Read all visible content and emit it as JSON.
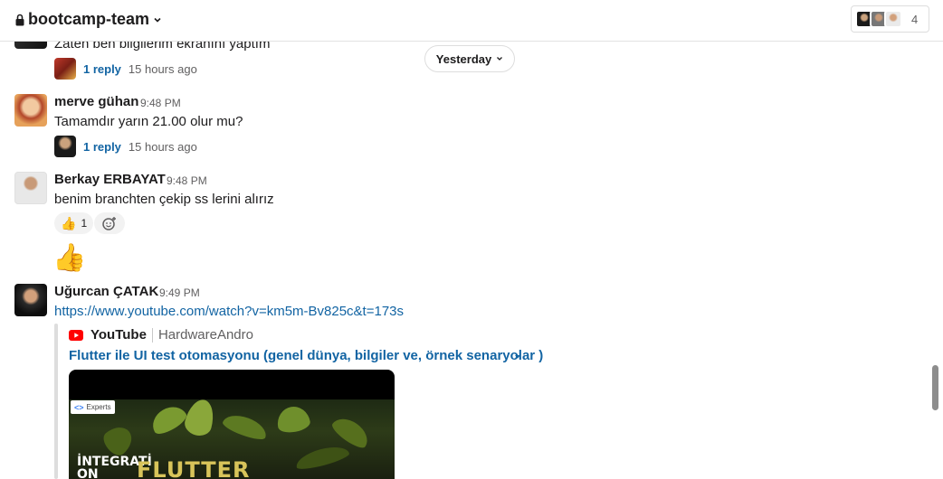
{
  "header": {
    "channel_name": "bootcamp-team",
    "member_count": "4"
  },
  "date_divider": "Yesterday",
  "messages": [
    {
      "text": "Zaten ben bilgilerim ekranını yaptım",
      "thread": {
        "reply_label": "1 reply",
        "ago": "15 hours ago"
      }
    },
    {
      "sender": "merve gühan",
      "time": "9:48 PM",
      "text": "Tamamdır yarın 21.00 olur mu?",
      "thread": {
        "reply_label": "1 reply",
        "ago": "15 hours ago"
      }
    },
    {
      "sender": "Berkay ERBAYAT",
      "time": "9:48 PM",
      "text": "benim branchten çekip ss lerini alırız",
      "reaction": {
        "emoji": "👍",
        "count": "1"
      },
      "followup_emoji": "👍"
    },
    {
      "sender": "Uğurcan ÇATAK",
      "time": "9:49 PM",
      "link": "https://www.youtube.com/watch?v=km5m-Bv825c&t=173s",
      "unfurl": {
        "service": "YouTube",
        "author": "HardwareAndro",
        "title": "Flutter ile UI test otomasyonu (genel dünya, bilgiler ve, örnek senaryolar )",
        "thumb_badge": "Experts",
        "thumb_text_left": "İNTEGRATİ ON",
        "thumb_text_main": "FLUTTER"
      }
    }
  ],
  "colors": {
    "link": "#1264a3",
    "youtube_red": "#ff0000",
    "reaction_bg": "#f2f2f2"
  }
}
